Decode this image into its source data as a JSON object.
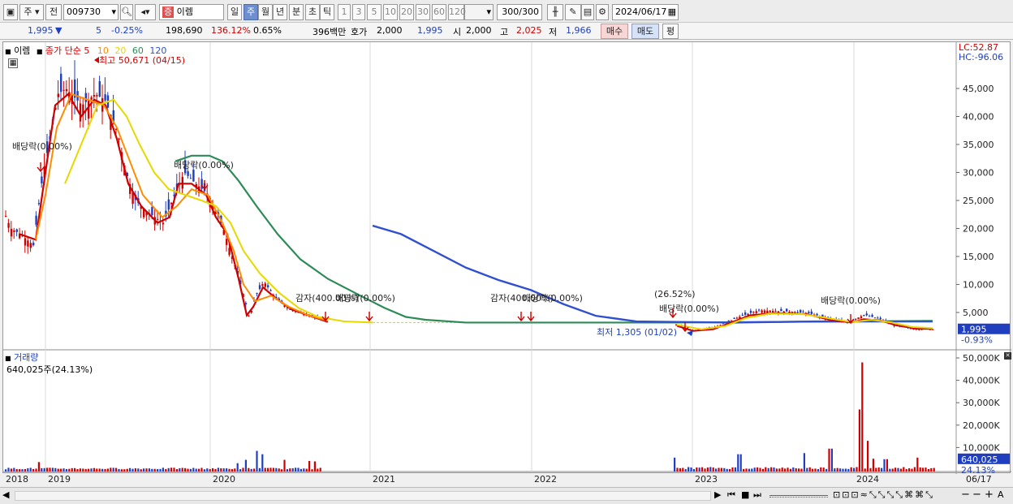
{
  "toolbar": {
    "period_type": "주",
    "prev_label": "전",
    "code": "009730",
    "stock_name": "이렘",
    "tabs": [
      "일",
      "주",
      "월",
      "년",
      "분",
      "초",
      "틱"
    ],
    "active_tab": "주",
    "intervals": [
      "1",
      "3",
      "5",
      "10",
      "20",
      "30",
      "60",
      "120"
    ],
    "count": "300",
    "count_total": "/300",
    "date": "2024/06/17"
  },
  "infobar": {
    "price": "1,995",
    "change": "5",
    "change_pct": "-0.25%",
    "volume": "198,690",
    "volume_ratio": "136.12%",
    "turnover": "0.65%",
    "amount": "396백만",
    "quote_label": "호가",
    "quote": "2,000",
    "price2": "1,995",
    "open_label": "시",
    "open": "2,000",
    "high_label": "고",
    "high": "2,025",
    "low_label": "저",
    "low": "1,966",
    "buy_label": "매수",
    "sell_label": "매도",
    "eval_label": "평"
  },
  "price_panel": {
    "name_label": "이렘",
    "ma_label": "종가 단순",
    "ma_periods": [
      "5",
      "10",
      "20",
      "60",
      "120"
    ],
    "ma_colors": [
      "#d00000",
      "#ff8c00",
      "#e8d800",
      "#2e8b57",
      "#3050d0"
    ],
    "high_note": "최고 50,671 (04/15)",
    "low_note": "최저 1,305 (01/02)",
    "lc": "LC:52.87",
    "hc": "HC:-96.06",
    "current_price": "1,995",
    "current_pct": "-0.93%",
    "y_ticks": [
      "45,000",
      "40,000",
      "35,000",
      "30,000",
      "25,000",
      "20,000",
      "15,000",
      "10,000",
      "5,000"
    ],
    "annotations": [
      "배당락(0.00%)",
      "배당락(0.00%)",
      "감자(400.00%)",
      "배당락(0.00%)",
      "감자(400.00%)",
      "배당락(0.00%)",
      "(26.52%)",
      "배당락(0.00%)",
      "배당락(0.00%)"
    ]
  },
  "volume_panel": {
    "title": "거래량",
    "value": "640,025주(24.13%)",
    "y_ticks": [
      "50,000K",
      "40,000K",
      "30,000K",
      "20,000K",
      "10,000K"
    ],
    "current": "640,025",
    "current_pct": "24.13%"
  },
  "x_labels": [
    "2018",
    "2019",
    "2020",
    "2021",
    "2022",
    "2023",
    "2024",
    "06/17"
  ],
  "colors": {
    "up": "#d00000",
    "down": "#1f3fbf",
    "selected_tab": "#6d8fd0"
  }
}
